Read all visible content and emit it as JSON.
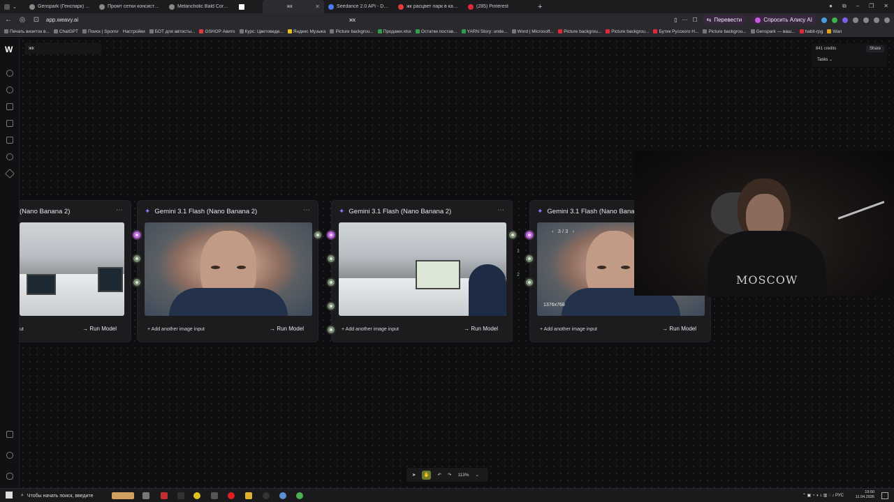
{
  "browser": {
    "tabs": [
      {
        "title": "Genspark (Генспарк) — в...",
        "color": "#888"
      },
      {
        "title": "Промт сетки консистент...",
        "color": "#888"
      },
      {
        "title": "Melancholic Bald Corpora...",
        "color": "#888"
      },
      {
        "title": "",
        "color": "#ffffff",
        "active": true
      },
      {
        "title": "жк",
        "color": "#666"
      },
      {
        "title": "Seedance 2.0 API - Docs...",
        "color": "#4a7cf0"
      },
      {
        "title": "жк расцвет парк в калин...",
        "color": "#e03a3a"
      },
      {
        "title": "(285) Pinterest",
        "color": "#e0283a"
      }
    ],
    "url": "app.weavy.ai",
    "page_title": "жк",
    "translate_label": "Перевести",
    "alice_label": "Спросить Алису AI",
    "bookmarks": [
      "Печать визиток в...",
      "ChatGPT",
      "Поиск | Sponsr",
      "Настройки",
      "БОТ для автосты...",
      "GSHOP Авито",
      "Курс: Цветоведе...",
      "Яндекс Музыка",
      "Picture backgrou...",
      "Продажи.xlsx",
      "Остатки постав...",
      "YARN Story: unde...",
      "Word | Microsoft...",
      "Picture backgrou...",
      "Picture backgrou...",
      "Бутик Русского Н...",
      "Picture backgrou...",
      "Genspark — ваш...",
      "habit-rpg",
      "Wan"
    ]
  },
  "app": {
    "project_name": "жк",
    "credits": "841 credits",
    "share_label": "Share",
    "tasks_label": "Tasks"
  },
  "nodes": [
    {
      "title": "(Nano Banana 2)",
      "footer": "ut",
      "run": "Run Model"
    },
    {
      "title": "Gemini 3.1 Flash (Nano Banana 2)",
      "footer": "Add another image input",
      "run": "Run Model"
    },
    {
      "title": "Gemini 3.1 Flash (Nano Banana 2)",
      "footer": "Add another image input",
      "run": "Run Model"
    },
    {
      "title": "Gemini 3.1 Flash (Nano Banan",
      "footer": "Add another image input",
      "run": "Run Model",
      "pager": "3 / 3",
      "resolution": "1376x768"
    }
  ],
  "connector_labels": [
    "1",
    "2"
  ],
  "webcam": {
    "shirt_text": "MOSCOW"
  },
  "toolbar": {
    "zoom": "113%"
  },
  "taskbar": {
    "search_placeholder": "Чтобы начать поиск, введите",
    "lang": "РУС",
    "time": "19:50",
    "date": "11.04.2026"
  }
}
